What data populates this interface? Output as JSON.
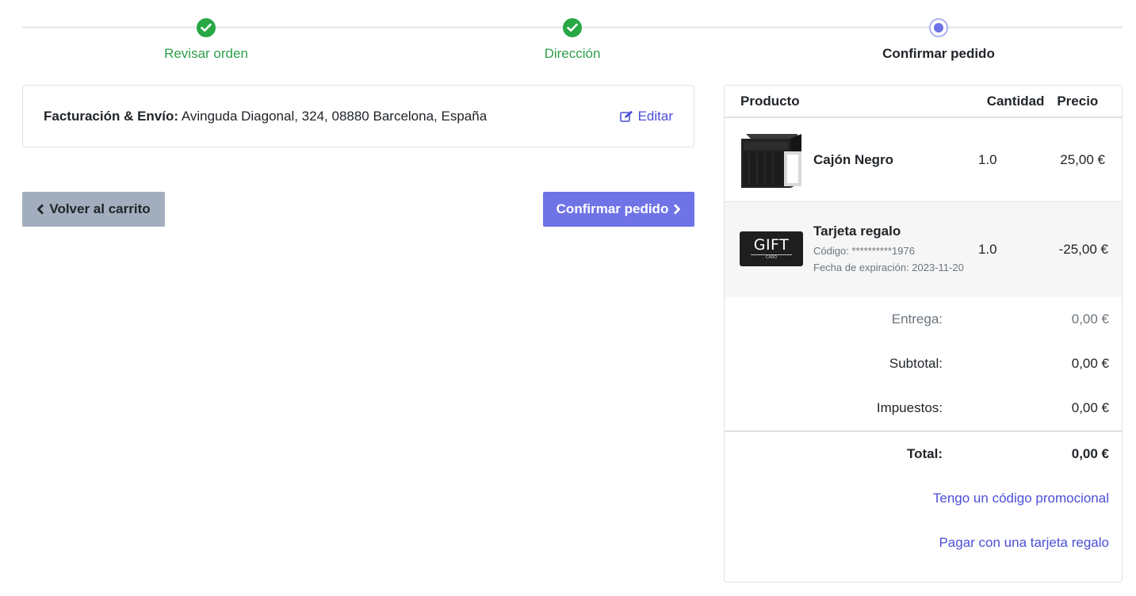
{
  "wizard": {
    "steps": [
      {
        "label": "Revisar orden",
        "status": "done"
      },
      {
        "label": "Dirección",
        "status": "done"
      },
      {
        "label": "Confirmar pedido",
        "status": "current"
      }
    ]
  },
  "address": {
    "label": "Facturación & Envío:",
    "value": "Avinguda Diagonal, 324, 08880 Barcelona, España",
    "edit_label": "Editar"
  },
  "actions": {
    "back_label": "Volver al carrito",
    "confirm_label": "Confirmar pedido"
  },
  "summary": {
    "headers": {
      "product": "Producto",
      "quantity": "Cantidad",
      "price": "Precio"
    },
    "items": [
      {
        "name": "Cajón Negro",
        "quantity": "1.0",
        "price": "25,00 €",
        "icon": "drawer-cabinet-image"
      },
      {
        "name": "Tarjeta regalo",
        "code": "Código: **********1976",
        "expiry": "Fecha de expiración: 2023-11-20",
        "quantity": "1.0",
        "price": "-25,00 €",
        "icon": "gift-card-image",
        "image_text": "GIFT",
        "image_subtext": "CARD"
      }
    ],
    "delivery_label": "Entrega:",
    "delivery_value": "0,00 €",
    "subtotal_label": "Subtotal:",
    "subtotal_value": "0,00 €",
    "tax_label": "Impuestos:",
    "tax_value": "0,00 €",
    "total_label": "Total:",
    "total_value": "0,00 €",
    "promo_link": "Tengo un código promocional",
    "giftcard_link": "Pagar con una tarjeta regalo"
  },
  "colors": {
    "done": "#28a745",
    "accent": "#6f73e6",
    "link": "#4a4fd6",
    "back_button": "#a2adbd"
  }
}
